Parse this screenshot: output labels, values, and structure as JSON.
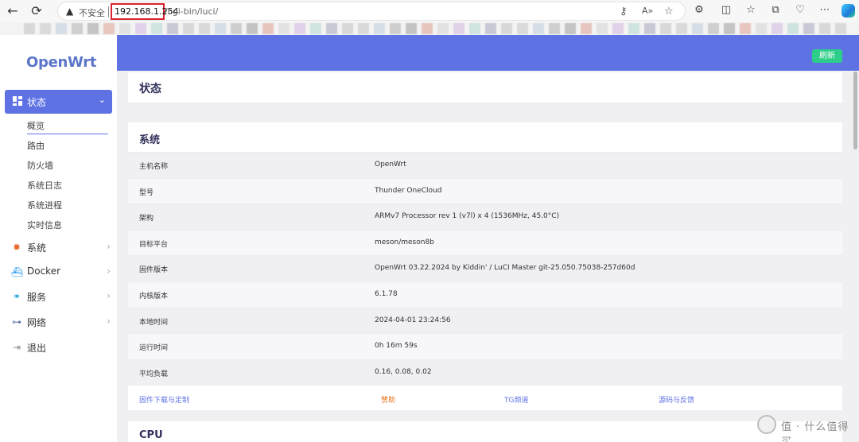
{
  "browser": {
    "insecure_label": "不安全",
    "host": "192.168.1.254",
    "path": "/cgi-bin/luci/",
    "icons": [
      "back-icon",
      "reload-icon",
      "key-icon",
      "read-aloud-icon",
      "star-icon",
      "extensions-icon",
      "split-screen-icon",
      "favorites-icon",
      "collections-icon",
      "browser-essentials-icon",
      "more-icon",
      "copilot-icon"
    ]
  },
  "sidebar": {
    "logo": "OpenWrt",
    "active_menu": {
      "label": "状态",
      "icon": "dashboard-icon"
    },
    "submenu": [
      "概览",
      "路由",
      "防火墙",
      "系统日志",
      "系统进程",
      "实时信息"
    ],
    "menus": [
      {
        "label": "系统",
        "icon": "gear-icon",
        "color": "#e66b2f"
      },
      {
        "label": "Docker",
        "icon": "docker-icon",
        "color": "#2496ed"
      },
      {
        "label": "服务",
        "icon": "services-icon",
        "color": "#1ba0d7"
      },
      {
        "label": "网络",
        "icon": "network-icon",
        "color": "#5a6fa8"
      },
      {
        "label": "退出",
        "icon": "logout-icon",
        "color": "#888888"
      }
    ]
  },
  "main": {
    "refresh_label": "刷新",
    "page_title": "状态",
    "system_card": {
      "title": "系统",
      "rows": [
        {
          "key": "主机名称",
          "value": "OpenWrt"
        },
        {
          "key": "型号",
          "value": "Thunder OneCloud"
        },
        {
          "key": "架构",
          "value": "ARMv7 Processor rev 1 (v7l) x 4 (1536MHz, 45.0°C)"
        },
        {
          "key": "目标平台",
          "value": "meson/meson8b"
        },
        {
          "key": "固件版本",
          "value": "OpenWrt 03.22.2024 by Kiddin' / LuCI Master git-25.050.75038-257d60d"
        },
        {
          "key": "内核版本",
          "value": "6.1.78"
        },
        {
          "key": "本地时间",
          "value": "2024-04-01 23:24:56"
        },
        {
          "key": "运行时间",
          "value": "0h 16m 59s"
        },
        {
          "key": "平均负载",
          "value": "0.16, 0.08, 0.02"
        }
      ],
      "links": [
        {
          "label": "固件下载与定制",
          "color": "#5e72e4"
        },
        {
          "label": "赞助",
          "color": "#e6721e"
        },
        {
          "label": "TG频道",
          "color": "#5e72e4"
        },
        {
          "label": "源码与反馈",
          "color": "#5e72e4"
        }
      ]
    },
    "cpu_card_title": "CPU"
  },
  "watermark": "值 · 什么值得买"
}
